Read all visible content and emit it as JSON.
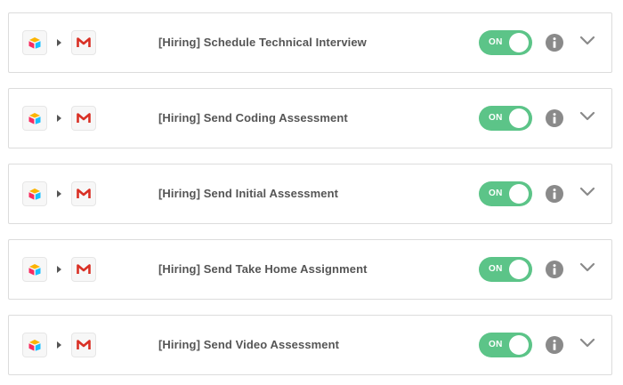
{
  "zaps": [
    {
      "title": "[Hiring] Schedule Technical Interview",
      "toggle": "ON",
      "trigger_app_icon": "airtable-icon",
      "action_app_icon": "gmail-icon"
    },
    {
      "title": "[Hiring] Send Coding Assessment",
      "toggle": "ON",
      "trigger_app_icon": "airtable-icon",
      "action_app_icon": "gmail-icon"
    },
    {
      "title": "[Hiring] Send Initial Assessment",
      "toggle": "ON",
      "trigger_app_icon": "airtable-icon",
      "action_app_icon": "gmail-icon"
    },
    {
      "title": "[Hiring] Send Take Home Assignment",
      "toggle": "ON",
      "trigger_app_icon": "airtable-icon",
      "action_app_icon": "gmail-icon"
    },
    {
      "title": "[Hiring] Send Video Assessment",
      "toggle": "ON",
      "trigger_app_icon": "airtable-icon",
      "action_app_icon": "gmail-icon"
    }
  ],
  "colors": {
    "toggle_on": "#5cc488",
    "info": "#8a8a8a",
    "chevron": "#8a8a8a",
    "title": "#555555",
    "card_border": "#dcdcdc"
  }
}
